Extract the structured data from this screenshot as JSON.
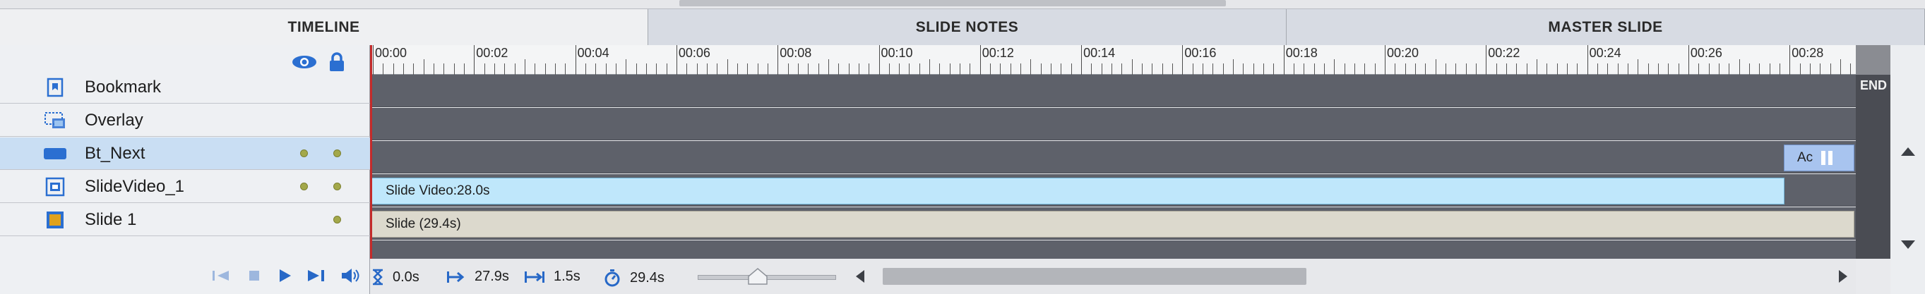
{
  "tabs": [
    {
      "label": "TIMELINE",
      "state": "active"
    },
    {
      "label": "SLIDE NOTES",
      "state": "inactive"
    },
    {
      "label": "MASTER SLIDE",
      "state": "inactive"
    }
  ],
  "header_icons": {
    "visibility": "eye-icon",
    "lock": "lock-icon"
  },
  "layers": [
    {
      "label": "Bookmark",
      "icon": "bookmark-icon",
      "selected": false
    },
    {
      "label": "Overlay",
      "icon": "overlay-icon",
      "selected": false
    },
    {
      "label": "Bt_Next",
      "icon": "button-shape-icon",
      "selected": true
    },
    {
      "label": "SlideVideo_1",
      "icon": "video-icon",
      "selected": false
    },
    {
      "label": "Slide 1",
      "icon": "slide-icon",
      "selected": false
    }
  ],
  "ruler": {
    "labels": [
      "00:00",
      "00:02",
      "00:04",
      "00:06",
      "00:08",
      "00:10",
      "00:12",
      "00:14",
      "00:16",
      "00:18",
      "00:20",
      "00:22",
      "00:24",
      "00:26",
      "00:28"
    ]
  },
  "tracks": {
    "bt_next_bar": "Ac",
    "video_bar": "Slide Video:28.0s",
    "slide_bar": "Slide (29.4s)"
  },
  "end_label": "END",
  "controls": {
    "current_time": "0.0s",
    "start_time": "27.9s",
    "duration": "1.5s",
    "total_time": "29.4s"
  },
  "colors": {
    "accent": "#2768c7",
    "playhead": "#c42b2b",
    "track_bg": "#5e616a",
    "video_bar": "#bfe7fb",
    "slide_bar": "#dcd9cd",
    "button_bar": "#a8c4ef"
  }
}
